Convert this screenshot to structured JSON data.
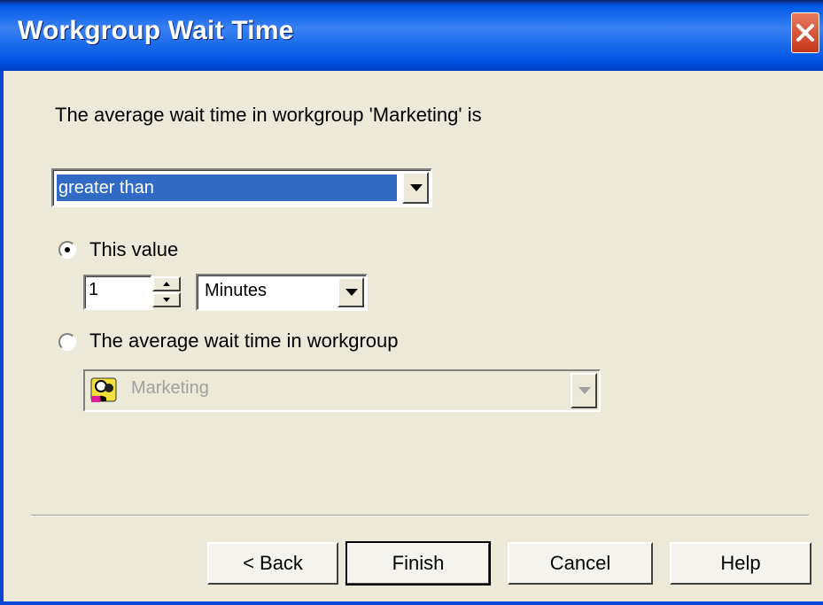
{
  "window": {
    "title": "Workgroup Wait Time"
  },
  "prompt": "The average wait time in workgroup 'Marketing' is",
  "comparison": {
    "selected": "greater than"
  },
  "option_value": {
    "label": "This value",
    "checked": true,
    "amount": "1",
    "unit": "Minutes"
  },
  "option_workgroup": {
    "label": "The average wait time in workgroup",
    "checked": false,
    "workgroup": "Marketing",
    "icon": "workgroup-icon"
  },
  "buttons": {
    "back": "< Back",
    "finish": "Finish",
    "cancel": "Cancel",
    "help": "Help"
  },
  "colors": {
    "title_bar": "#0058E6",
    "selection": "#316AC5",
    "face": "#ECE9D8"
  }
}
